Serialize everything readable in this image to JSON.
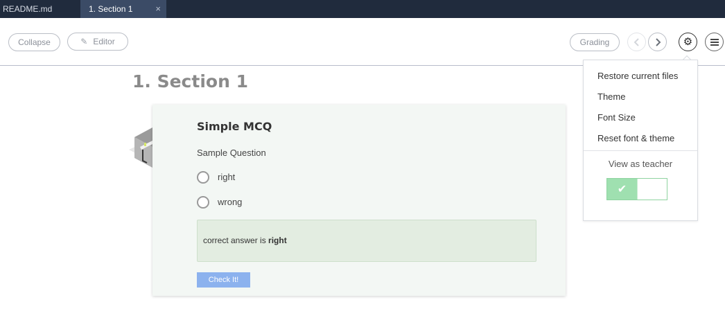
{
  "tabs": [
    {
      "label": "README.md"
    },
    {
      "label": "1. Section 1",
      "close": "×"
    }
  ],
  "toolbar": {
    "collapse_label": "Collapse",
    "editor_label": "Editor",
    "grading_label": "Grading"
  },
  "dropdown": {
    "items": [
      "Restore current files",
      "Theme",
      "Font Size",
      "Reset font & theme"
    ],
    "view_as_teacher": "View as teacher",
    "toggle_on": true
  },
  "section": {
    "title": "1. Section 1"
  },
  "mcq": {
    "title": "Simple MCQ",
    "question": "Sample Question",
    "options": [
      "right",
      "wrong"
    ],
    "answer_prefix": "correct answer is ",
    "answer_value": "right",
    "check_label": "Check It!"
  },
  "colors": {
    "tabbar": "#202b3d",
    "active_tab": "#3b4b66",
    "card_bg": "#f3f7f4",
    "answer_bg": "#e3ede1",
    "check_button": "#8cb2ee",
    "toggle_on": "#9fe0b0"
  }
}
